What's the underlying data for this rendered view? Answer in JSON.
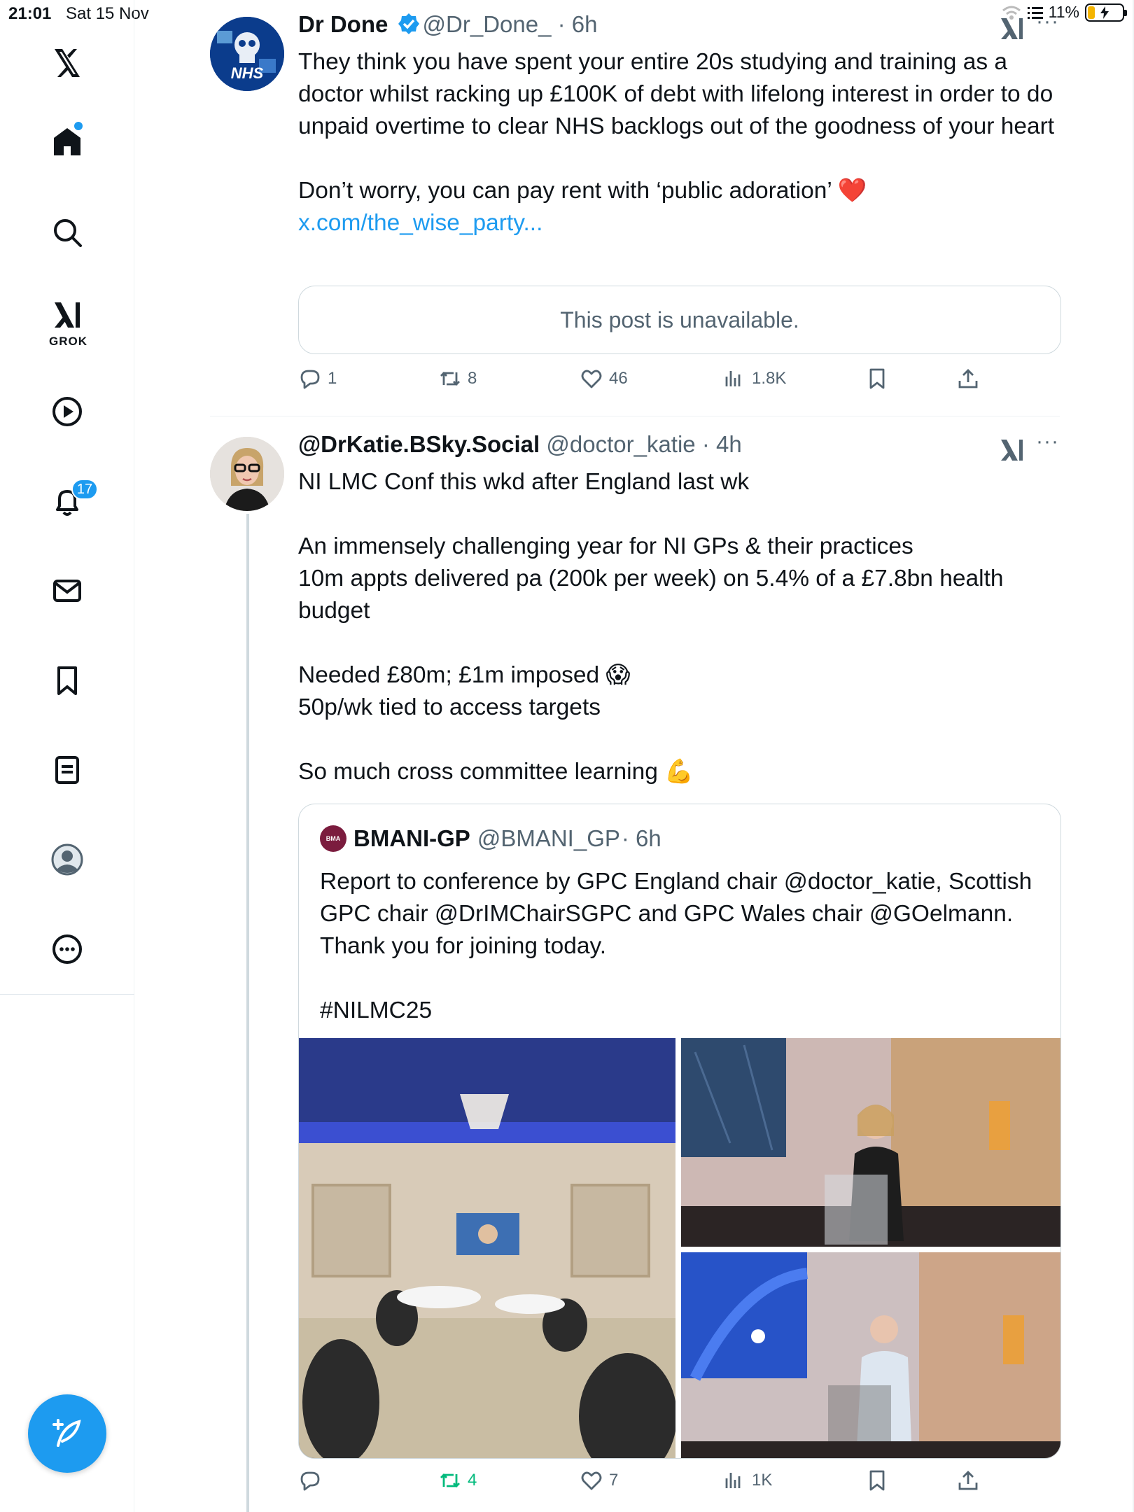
{
  "status_bar": {
    "time": "21:01",
    "date": "Sat 15 Nov",
    "battery": "11%"
  },
  "sidebar": {
    "grok_label": "GROK",
    "notifications_count": "17"
  },
  "post1": {
    "name": "Dr Done",
    "handle": "@Dr_Done_",
    "time": "· 6h",
    "paragraphs": [
      "They think you have spent your entire 20s studying and training as a doctor whilst racking up £100K of debt with lifelong interest in order to do unpaid overtime to clear NHS backlogs out of the goodness of your heart"
    ],
    "text2": "Don’t worry, you can pay rent with ‘public adoration’ ❤️ ",
    "link": "x.com/the_wise_party...",
    "unavailable": "This post is unavailable.",
    "avatar_text": "NHS",
    "stats": {
      "replies": "1",
      "reposts": "8",
      "likes": "46",
      "views": "1.8K"
    }
  },
  "post2": {
    "name": "@DrKatie.BSky.Social",
    "handle": "@doctor_katie",
    "time": "· 4h",
    "paragraphs": [
      "NI LMC Conf this wkd after England last wk",
      "An immensely challenging year for NI GPs & their practices\n10m appts delivered pa (200k per week) on 5.4% of a £7.8bn health budget",
      "Needed £80m; £1m imposed 😱\n50p/wk tied to access targets",
      "So much cross committee learning 💪"
    ],
    "quote": {
      "avatar_text": "BMA",
      "name": "BMANI-GP",
      "handle": "@BMANI_GP",
      "time": "· 6h",
      "paragraphs": [
        "Report to conference by GPC England chair @doctor_katie, Scottish GPC chair @DrIMChairSGPC and GPC Wales chair @GOelmann. Thank you for joining today.",
        "#NILMC25"
      ]
    },
    "stats": {
      "replies": "",
      "reposts": "4",
      "likes": "7",
      "views": "1K"
    }
  }
}
